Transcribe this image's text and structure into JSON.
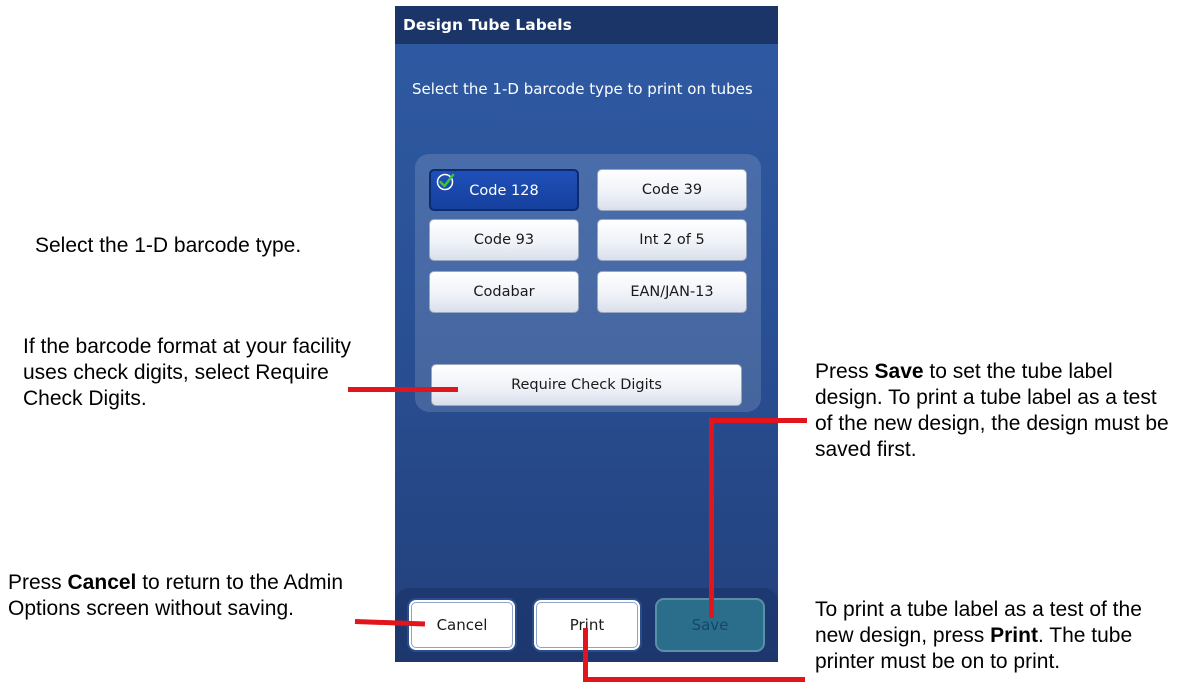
{
  "screen": {
    "title": "Design Tube Labels",
    "instruction": "Select the 1-D barcode type to print on tubes",
    "barcode_types": [
      "Code 128",
      "Code 39",
      "Code 93",
      "Int 2 of 5",
      "Codabar",
      "EAN/JAN-13"
    ],
    "selected_barcode": "Code 128",
    "check_digits_label": "Require Check Digits",
    "cancel_label": "Cancel",
    "print_label": "Print",
    "save_label": "Save",
    "save_enabled": false
  },
  "callouts": {
    "barcode_type": "Select the 1-D barcode type.",
    "check_digits": "If the barcode format at your facility uses check digits, select Require Check Digits.",
    "save_pre": "Press ",
    "save_bold": "Save",
    "save_post": " to set the tube label design. To print a tube label as a test of the new design, the design must be saved first.",
    "cancel_pre": "Press ",
    "cancel_bold": "Cancel",
    "cancel_post": " to return to the Admin Options screen without saving.",
    "print_pre": "To print a tube label as a test of the new design, press ",
    "print_bold": "Print",
    "print_post": ". The tube printer must be on to print."
  },
  "colors": {
    "accent_red": "#e2141c",
    "title_bar": "#1b3568",
    "selected_button": "#1f4fb8",
    "check_icon": "#3cc13c"
  }
}
